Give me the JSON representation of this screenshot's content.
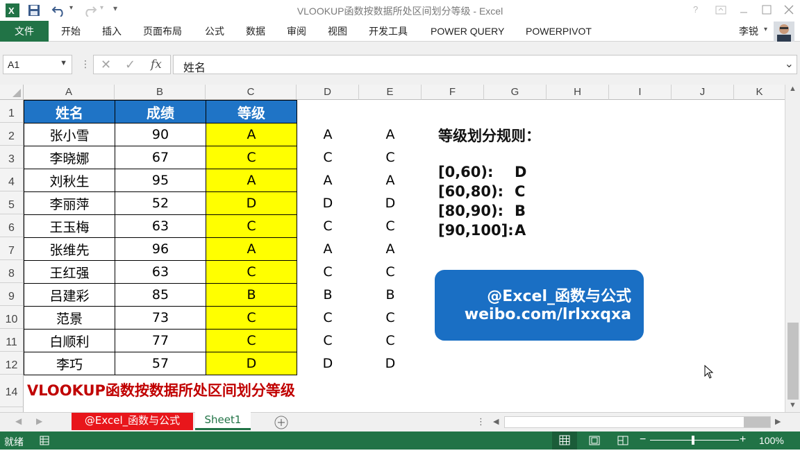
{
  "window": {
    "title": "VLOOKUP函数按数据所处区间划分等级 - Excel"
  },
  "ribbon": {
    "tabs": [
      "文件",
      "开始",
      "插入",
      "页面布局",
      "公式",
      "数据",
      "审阅",
      "视图",
      "开发工具",
      "POWER QUERY",
      "POWERPIVOT"
    ],
    "user": "李锐"
  },
  "formula_bar": {
    "name_box": "A1",
    "fx_label": "fx",
    "content": "姓名"
  },
  "columns": [
    "A",
    "B",
    "C",
    "D",
    "E",
    "F",
    "G",
    "H",
    "I",
    "J",
    "K"
  ],
  "rows": [
    "1",
    "2",
    "3",
    "4",
    "5",
    "6",
    "7",
    "8",
    "9",
    "10",
    "11",
    "12",
    "14"
  ],
  "table": {
    "headers": [
      "姓名",
      "成绩",
      "等级"
    ],
    "rows": [
      [
        "张小雪",
        "90",
        "A",
        "A",
        "A"
      ],
      [
        "李晓娜",
        "67",
        "C",
        "C",
        "C"
      ],
      [
        "刘秋生",
        "95",
        "A",
        "A",
        "A"
      ],
      [
        "李丽萍",
        "52",
        "D",
        "D",
        "D"
      ],
      [
        "王玉梅",
        "63",
        "C",
        "C",
        "C"
      ],
      [
        "张维先",
        "96",
        "A",
        "A",
        "A"
      ],
      [
        "王红强",
        "63",
        "C",
        "C",
        "C"
      ],
      [
        "吕建彩",
        "85",
        "B",
        "B",
        "B"
      ],
      [
        "范景",
        "73",
        "C",
        "C",
        "C"
      ],
      [
        "白顺利",
        "77",
        "C",
        "C",
        "C"
      ],
      [
        "李巧",
        "57",
        "D",
        "D",
        "D"
      ]
    ]
  },
  "rules": {
    "title": "等级划分规则：",
    "lines": [
      {
        "range": "[0,60):",
        "grade": "D"
      },
      {
        "range": "[60,80):",
        "grade": "C"
      },
      {
        "range": "[80,90):",
        "grade": "B"
      },
      {
        "range": "[90,100]:",
        "grade": "A"
      }
    ]
  },
  "banner": {
    "line1": "@Excel_函数与公式",
    "line2": "weibo.com/lrlxxqxa"
  },
  "caption": "VLOOKUP函数按数据所处区间划分等级",
  "sheet_tabs": [
    "@Excel_函数与公式",
    "Sheet1"
  ],
  "status": {
    "ready": "就绪",
    "zoom": "100%"
  },
  "colors": {
    "excel_green": "#217346",
    "header_blue": "#1f74c6",
    "grade_yellow": "#ffff00",
    "banner_blue": "#1a6fc4",
    "caption_red": "#c00000",
    "tab_red": "#e8161b"
  }
}
